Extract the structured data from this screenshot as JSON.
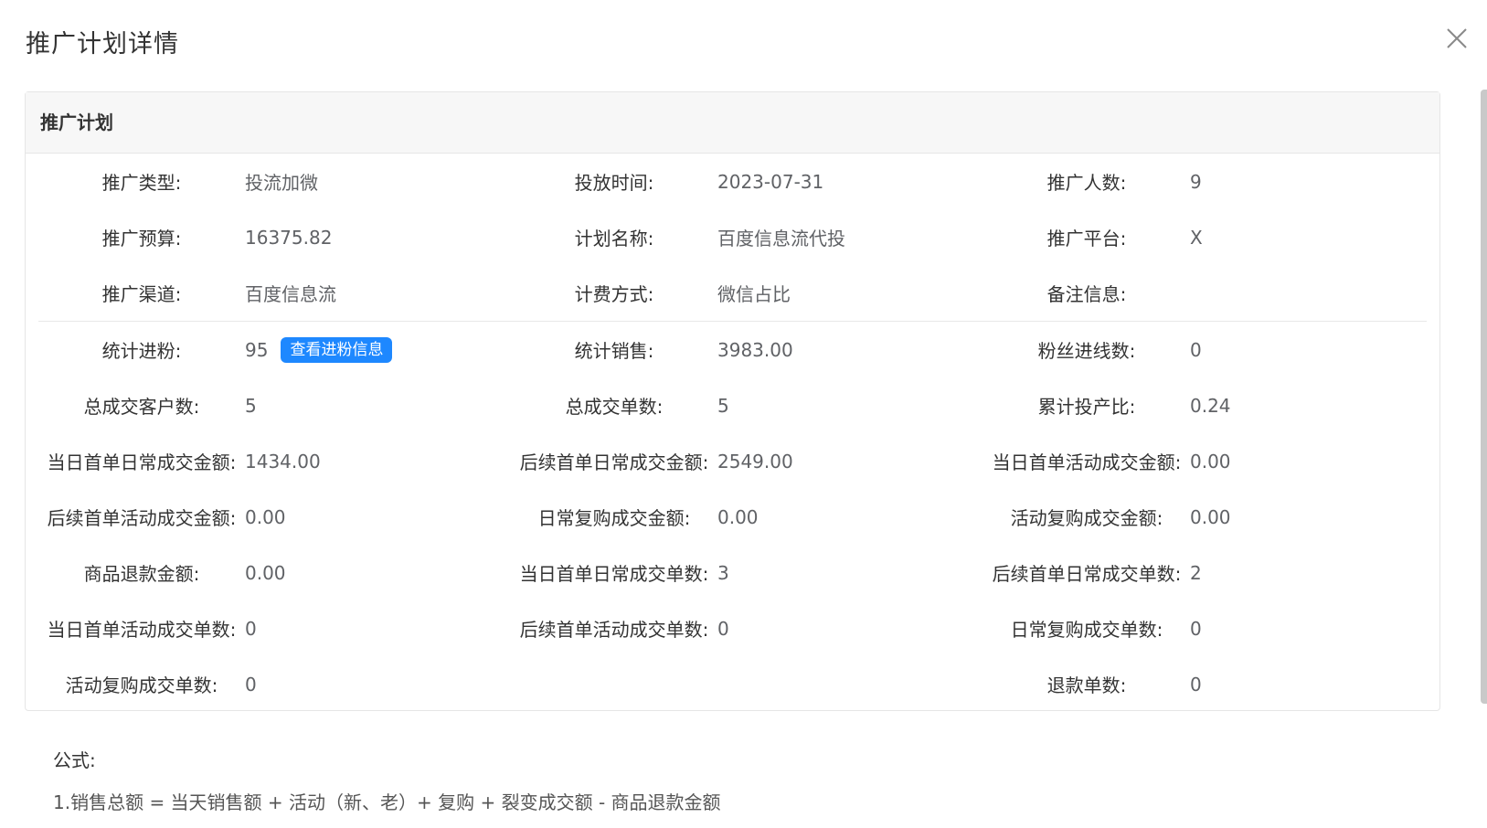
{
  "dialog": {
    "title": "推广计划详情",
    "close_icon": "close-icon"
  },
  "card": {
    "header": "推广计划"
  },
  "basic_info": [
    {
      "label": "推广类型:",
      "value": "投流加微"
    },
    {
      "label": "投放时间:",
      "value": "2023-07-31"
    },
    {
      "label": "推广人数:",
      "value": "9"
    },
    {
      "label": "推广预算:",
      "value": "16375.82"
    },
    {
      "label": "计划名称:",
      "value": "百度信息流代投"
    },
    {
      "label": "推广平台:",
      "value": "X"
    },
    {
      "label": "推广渠道:",
      "value": "百度信息流"
    },
    {
      "label": "计费方式:",
      "value": "微信占比"
    },
    {
      "label": "备注信息:",
      "value": ""
    }
  ],
  "stats": [
    {
      "label": "统计进粉:",
      "value": "95",
      "button": "查看进粉信息"
    },
    {
      "label": "统计销售:",
      "value": "3983.00"
    },
    {
      "label": "粉丝进线数:",
      "value": "0"
    },
    {
      "label": "总成交客户数:",
      "value": "5"
    },
    {
      "label": "总成交单数:",
      "value": "5"
    },
    {
      "label": "累计投产比:",
      "value": "0.24"
    },
    {
      "label": "当日首单日常成交金额:",
      "value": "1434.00"
    },
    {
      "label": "后续首单日常成交金额:",
      "value": "2549.00"
    },
    {
      "label": "当日首单活动成交金额:",
      "value": "0.00"
    },
    {
      "label": "后续首单活动成交金额:",
      "value": "0.00"
    },
    {
      "label": "日常复购成交金额:",
      "value": "0.00"
    },
    {
      "label": "活动复购成交金额:",
      "value": "0.00"
    },
    {
      "label": "商品退款金额:",
      "value": "0.00"
    },
    {
      "label": "当日首单日常成交单数:",
      "value": "3"
    },
    {
      "label": "后续首单日常成交单数:",
      "value": "2"
    },
    {
      "label": "当日首单活动成交单数:",
      "value": "0"
    },
    {
      "label": "后续首单活动成交单数:",
      "value": "0"
    },
    {
      "label": "日常复购成交单数:",
      "value": "0"
    },
    {
      "label": "活动复购成交单数:",
      "value": "0"
    },
    {
      "label": "",
      "value": ""
    },
    {
      "label": "退款单数:",
      "value": "0"
    }
  ],
  "formula": {
    "title": "公式:",
    "line1": "1.销售总额 = 当天销售额 + 活动（新、老）+ 复购 + 裂变成交额 - 商品退款金额"
  },
  "colors": {
    "primary": "#1e88ff",
    "header_bg": "#f7f7f7",
    "border": "#e6e6e6"
  }
}
